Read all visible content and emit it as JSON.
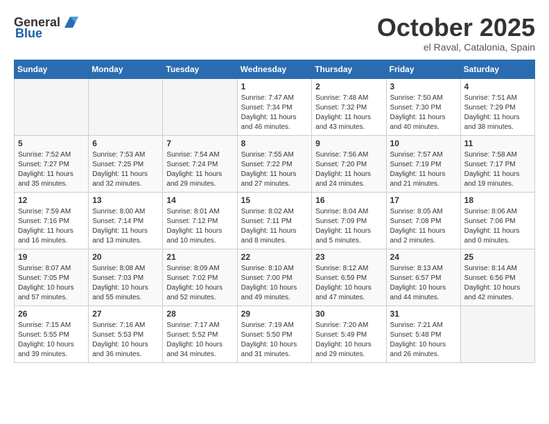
{
  "header": {
    "logo_general": "General",
    "logo_blue": "Blue",
    "month_title": "October 2025",
    "location": "el Raval, Catalonia, Spain"
  },
  "weekdays": [
    "Sunday",
    "Monday",
    "Tuesday",
    "Wednesday",
    "Thursday",
    "Friday",
    "Saturday"
  ],
  "weeks": [
    [
      {
        "day": "",
        "info": ""
      },
      {
        "day": "",
        "info": ""
      },
      {
        "day": "",
        "info": ""
      },
      {
        "day": "1",
        "info": "Sunrise: 7:47 AM\nSunset: 7:34 PM\nDaylight: 11 hours and 46 minutes."
      },
      {
        "day": "2",
        "info": "Sunrise: 7:48 AM\nSunset: 7:32 PM\nDaylight: 11 hours and 43 minutes."
      },
      {
        "day": "3",
        "info": "Sunrise: 7:50 AM\nSunset: 7:30 PM\nDaylight: 11 hours and 40 minutes."
      },
      {
        "day": "4",
        "info": "Sunrise: 7:51 AM\nSunset: 7:29 PM\nDaylight: 11 hours and 38 minutes."
      }
    ],
    [
      {
        "day": "5",
        "info": "Sunrise: 7:52 AM\nSunset: 7:27 PM\nDaylight: 11 hours and 35 minutes."
      },
      {
        "day": "6",
        "info": "Sunrise: 7:53 AM\nSunset: 7:25 PM\nDaylight: 11 hours and 32 minutes."
      },
      {
        "day": "7",
        "info": "Sunrise: 7:54 AM\nSunset: 7:24 PM\nDaylight: 11 hours and 29 minutes."
      },
      {
        "day": "8",
        "info": "Sunrise: 7:55 AM\nSunset: 7:22 PM\nDaylight: 11 hours and 27 minutes."
      },
      {
        "day": "9",
        "info": "Sunrise: 7:56 AM\nSunset: 7:20 PM\nDaylight: 11 hours and 24 minutes."
      },
      {
        "day": "10",
        "info": "Sunrise: 7:57 AM\nSunset: 7:19 PM\nDaylight: 11 hours and 21 minutes."
      },
      {
        "day": "11",
        "info": "Sunrise: 7:58 AM\nSunset: 7:17 PM\nDaylight: 11 hours and 19 minutes."
      }
    ],
    [
      {
        "day": "12",
        "info": "Sunrise: 7:59 AM\nSunset: 7:16 PM\nDaylight: 11 hours and 16 minutes."
      },
      {
        "day": "13",
        "info": "Sunrise: 8:00 AM\nSunset: 7:14 PM\nDaylight: 11 hours and 13 minutes."
      },
      {
        "day": "14",
        "info": "Sunrise: 8:01 AM\nSunset: 7:12 PM\nDaylight: 11 hours and 10 minutes."
      },
      {
        "day": "15",
        "info": "Sunrise: 8:02 AM\nSunset: 7:11 PM\nDaylight: 11 hours and 8 minutes."
      },
      {
        "day": "16",
        "info": "Sunrise: 8:04 AM\nSunset: 7:09 PM\nDaylight: 11 hours and 5 minutes."
      },
      {
        "day": "17",
        "info": "Sunrise: 8:05 AM\nSunset: 7:08 PM\nDaylight: 11 hours and 2 minutes."
      },
      {
        "day": "18",
        "info": "Sunrise: 8:06 AM\nSunset: 7:06 PM\nDaylight: 11 hours and 0 minutes."
      }
    ],
    [
      {
        "day": "19",
        "info": "Sunrise: 8:07 AM\nSunset: 7:05 PM\nDaylight: 10 hours and 57 minutes."
      },
      {
        "day": "20",
        "info": "Sunrise: 8:08 AM\nSunset: 7:03 PM\nDaylight: 10 hours and 55 minutes."
      },
      {
        "day": "21",
        "info": "Sunrise: 8:09 AM\nSunset: 7:02 PM\nDaylight: 10 hours and 52 minutes."
      },
      {
        "day": "22",
        "info": "Sunrise: 8:10 AM\nSunset: 7:00 PM\nDaylight: 10 hours and 49 minutes."
      },
      {
        "day": "23",
        "info": "Sunrise: 8:12 AM\nSunset: 6:59 PM\nDaylight: 10 hours and 47 minutes."
      },
      {
        "day": "24",
        "info": "Sunrise: 8:13 AM\nSunset: 6:57 PM\nDaylight: 10 hours and 44 minutes."
      },
      {
        "day": "25",
        "info": "Sunrise: 8:14 AM\nSunset: 6:56 PM\nDaylight: 10 hours and 42 minutes."
      }
    ],
    [
      {
        "day": "26",
        "info": "Sunrise: 7:15 AM\nSunset: 5:55 PM\nDaylight: 10 hours and 39 minutes."
      },
      {
        "day": "27",
        "info": "Sunrise: 7:16 AM\nSunset: 5:53 PM\nDaylight: 10 hours and 36 minutes."
      },
      {
        "day": "28",
        "info": "Sunrise: 7:17 AM\nSunset: 5:52 PM\nDaylight: 10 hours and 34 minutes."
      },
      {
        "day": "29",
        "info": "Sunrise: 7:19 AM\nSunset: 5:50 PM\nDaylight: 10 hours and 31 minutes."
      },
      {
        "day": "30",
        "info": "Sunrise: 7:20 AM\nSunset: 5:49 PM\nDaylight: 10 hours and 29 minutes."
      },
      {
        "day": "31",
        "info": "Sunrise: 7:21 AM\nSunset: 5:48 PM\nDaylight: 10 hours and 26 minutes."
      },
      {
        "day": "",
        "info": ""
      }
    ]
  ]
}
